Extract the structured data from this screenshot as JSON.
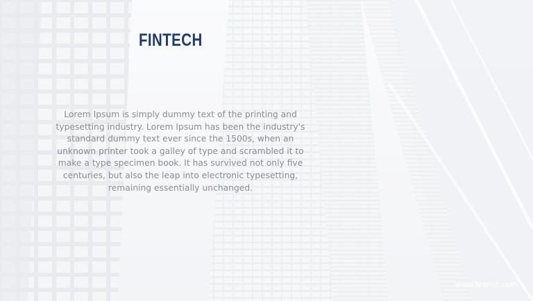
{
  "slide": {
    "title": "FINTECH",
    "body": "Lorem Ipsum is simply dummy text of the printing and typesetting industry. Lorem Ipsum has been the industry's standard dummy text ever since the 1500s, when an unknown printer took a galley of type and scrambled it to make a type specimen book. It has survived not only five centuries, but also the leap into electronic typesetting, remaining essentially unchanged.",
    "url": "www.fintech.com"
  },
  "colors": {
    "title": "#1f3a6b",
    "body_text": "#8a8d92",
    "background": "#f4f6f9"
  }
}
